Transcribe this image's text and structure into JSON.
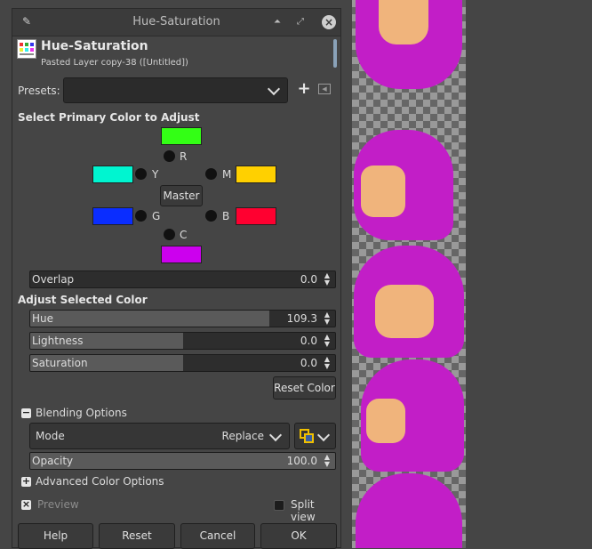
{
  "window": {
    "title": "Hue-Saturation"
  },
  "header": {
    "name": "Hue-Saturation",
    "subtitle": "Pasted Layer copy-38 ([Untitled])"
  },
  "presets": {
    "label": "Presets:",
    "value": ""
  },
  "primary": {
    "heading": "Select Primary Color to Adjust",
    "colors": {
      "R": "#33ff15",
      "Y": "#00f5d0",
      "M": "#ffd000",
      "G": "#0a2dff",
      "B": "#ff0030",
      "C": "#cc00ee"
    },
    "labels": {
      "R": "R",
      "Y": "Y",
      "M": "M",
      "G": "G",
      "B": "B",
      "C": "C"
    },
    "master": "Master"
  },
  "overlap": {
    "label": "Overlap",
    "value": "0.0",
    "fraction": 0
  },
  "adjust": {
    "heading": "Adjust Selected Color",
    "hue": {
      "label": "Hue",
      "value": "109.3",
      "fraction": 0.783
    },
    "lightness": {
      "label": "Lightness",
      "value": "0.0",
      "fraction": 0.5
    },
    "saturation": {
      "label": "Saturation",
      "value": "0.0",
      "fraction": 0.5
    }
  },
  "reset_color": "Reset Color",
  "blending": {
    "expander_label": "Blending Options",
    "mode_label": "Mode",
    "mode_value": "Replace",
    "opacity_label": "Opacity",
    "opacity_value": "100.0",
    "opacity_fraction": 1.0
  },
  "advanced": {
    "label": "Advanced Color Options"
  },
  "preview": {
    "label": "Preview"
  },
  "split_view": {
    "label": "Split view"
  },
  "buttons": {
    "help": "Help",
    "reset": "Reset",
    "cancel": "Cancel",
    "ok": "OK"
  }
}
